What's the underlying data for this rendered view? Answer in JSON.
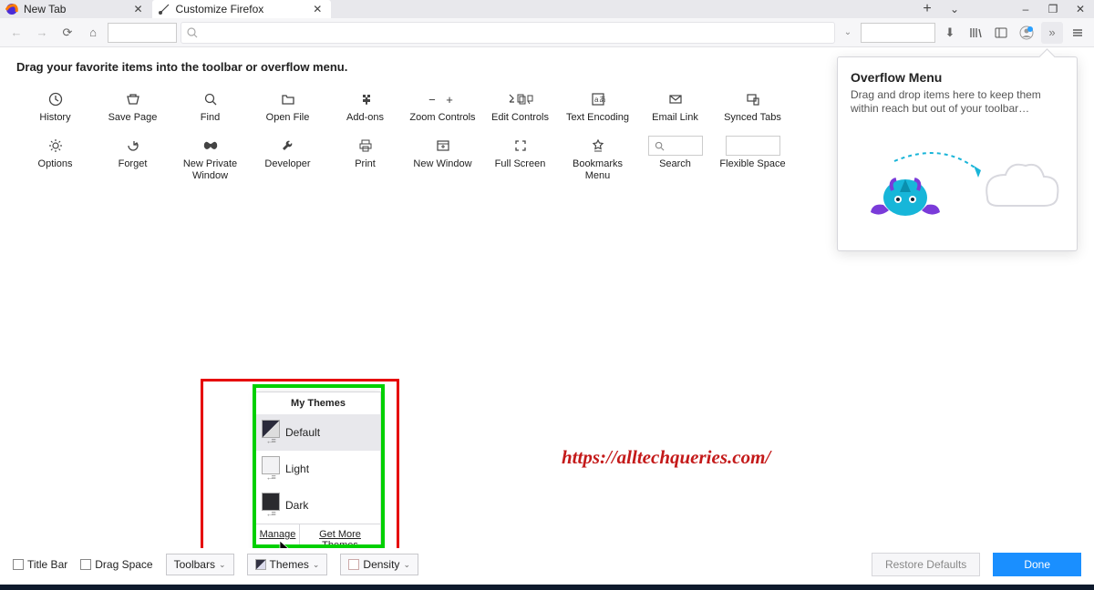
{
  "tabs": {
    "inactive": "New Tab",
    "active": "Customize Firefox"
  },
  "window_controls": {
    "new_tab_plus": "+",
    "minimize": "–",
    "maximize": "▢",
    "close": "✕"
  },
  "navbar": {
    "search_placeholder": ""
  },
  "customize_heading": "Drag your favorite items into the toolbar or overflow menu.",
  "items_row1": [
    "History",
    "Save Page",
    "Find",
    "Open File",
    "Add-ons",
    "Zoom Controls",
    "Edit Controls",
    "Text Encoding",
    "Email Link",
    "Synced Tabs"
  ],
  "items_row2": [
    "Options",
    "Forget",
    "New Private Window",
    "Developer",
    "Print",
    "New Window",
    "Full Screen",
    "Bookmarks Menu",
    "Search",
    "Flexible Space"
  ],
  "overflow": {
    "title": "Overflow Menu",
    "desc": "Drag and drop items here to keep them within reach but out of your toolbar…"
  },
  "themes_popup": {
    "header": "My Themes",
    "items": [
      "Default",
      "Light",
      "Dark"
    ],
    "manage": "Manage",
    "get_more": "Get More Themes"
  },
  "bottombar": {
    "title_bar": "Title Bar",
    "drag_space": "Drag Space",
    "toolbars": "Toolbars",
    "themes": "Themes",
    "density": "Density",
    "restore": "Restore Defaults",
    "done": "Done"
  },
  "watermark": "https://alltechqueries.com/"
}
